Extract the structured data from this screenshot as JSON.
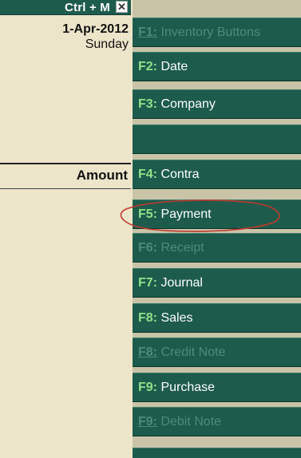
{
  "left_panel": {
    "shortcut_label": "Ctrl + M",
    "close_glyph": "✕",
    "date": "1-Apr-2012",
    "day": "Sunday",
    "amount_header": "Amount"
  },
  "buttons": [
    {
      "key": "F1:",
      "label": "Inventory Buttons",
      "enabled": false
    },
    {
      "key": "F2:",
      "label": "Date",
      "enabled": true
    },
    {
      "key": "F3:",
      "label": "Company",
      "enabled": true
    },
    {
      "key": "",
      "label": "",
      "enabled": true
    },
    {
      "key": "F4:",
      "label": "Contra",
      "enabled": true
    },
    {
      "key": "F5:",
      "label": "Payment",
      "enabled": true
    },
    {
      "key": "F6:",
      "label": "Receipt",
      "enabled": false
    },
    {
      "key": "F7:",
      "label": "Journal",
      "enabled": true
    },
    {
      "key": "F8:",
      "label": "Sales",
      "enabled": true
    },
    {
      "key": "F8:",
      "label": "Credit Note",
      "enabled": false
    },
    {
      "key": "F9:",
      "label": "Purchase",
      "enabled": true
    },
    {
      "key": "F9:",
      "label": "Debit Note",
      "enabled": false
    }
  ],
  "colors": {
    "panel_bg": "#ece5c9",
    "button_bg": "#1d5c4c",
    "key_color": "#8fe38a",
    "disabled_color": "#4f8a7a",
    "highlight_ring": "#c0392b"
  }
}
